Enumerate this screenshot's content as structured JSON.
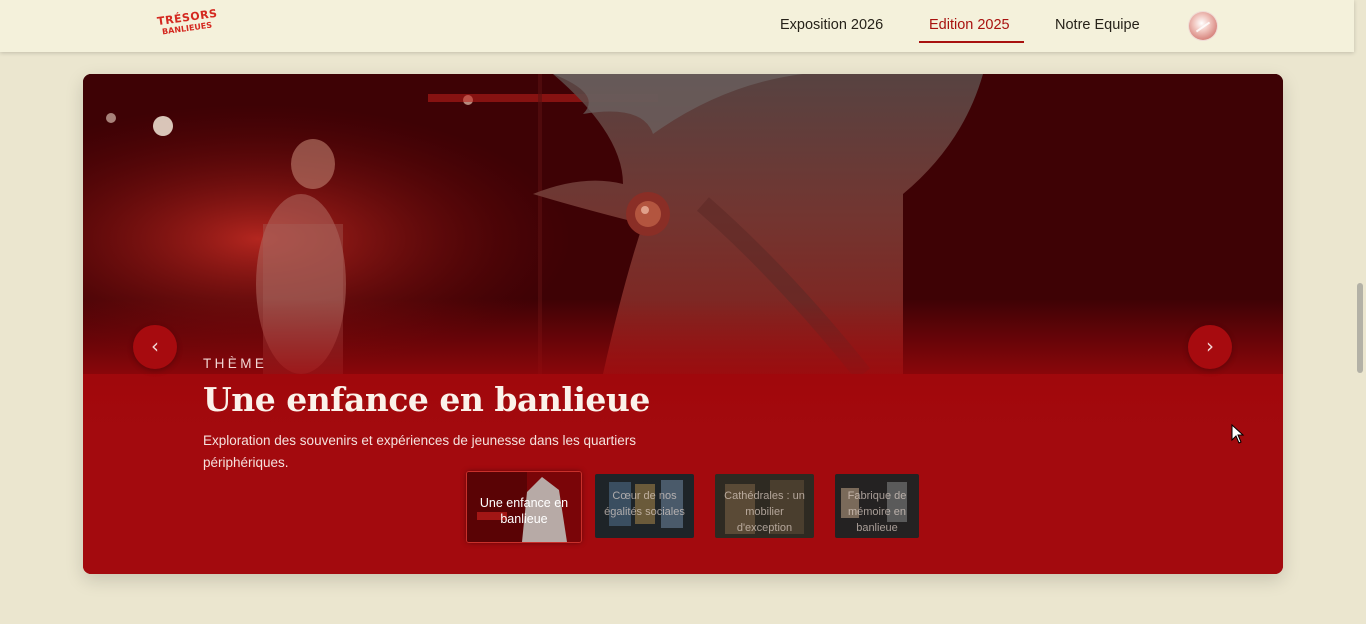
{
  "header": {
    "logo": {
      "line1": "TRÉSORS",
      "line2": "BANLIEUES"
    },
    "nav": [
      {
        "label": "Exposition 2026",
        "active": false
      },
      {
        "label": "Edition 2025",
        "active": true
      },
      {
        "label": "Notre Equipe",
        "active": false
      }
    ],
    "accent_color": "#a8120f"
  },
  "hero": {
    "eyebrow": "THÈME",
    "title": "Une enfance en banlieue",
    "description": "Exploration des souvenirs et expériences de jeunesse dans les quartiers périphériques.",
    "prev_icon": "‹",
    "next_icon": "›",
    "background_color": "#a30a0e",
    "thumbnails": [
      {
        "label": "Une enfance en banlieue",
        "active": true
      },
      {
        "label": "Cœur de nos égalités sociales",
        "active": false
      },
      {
        "label": "Cathédrales : un mobilier d'exception",
        "active": false
      },
      {
        "label": "Fabrique de mémoire en banlieue",
        "active": false
      }
    ]
  }
}
